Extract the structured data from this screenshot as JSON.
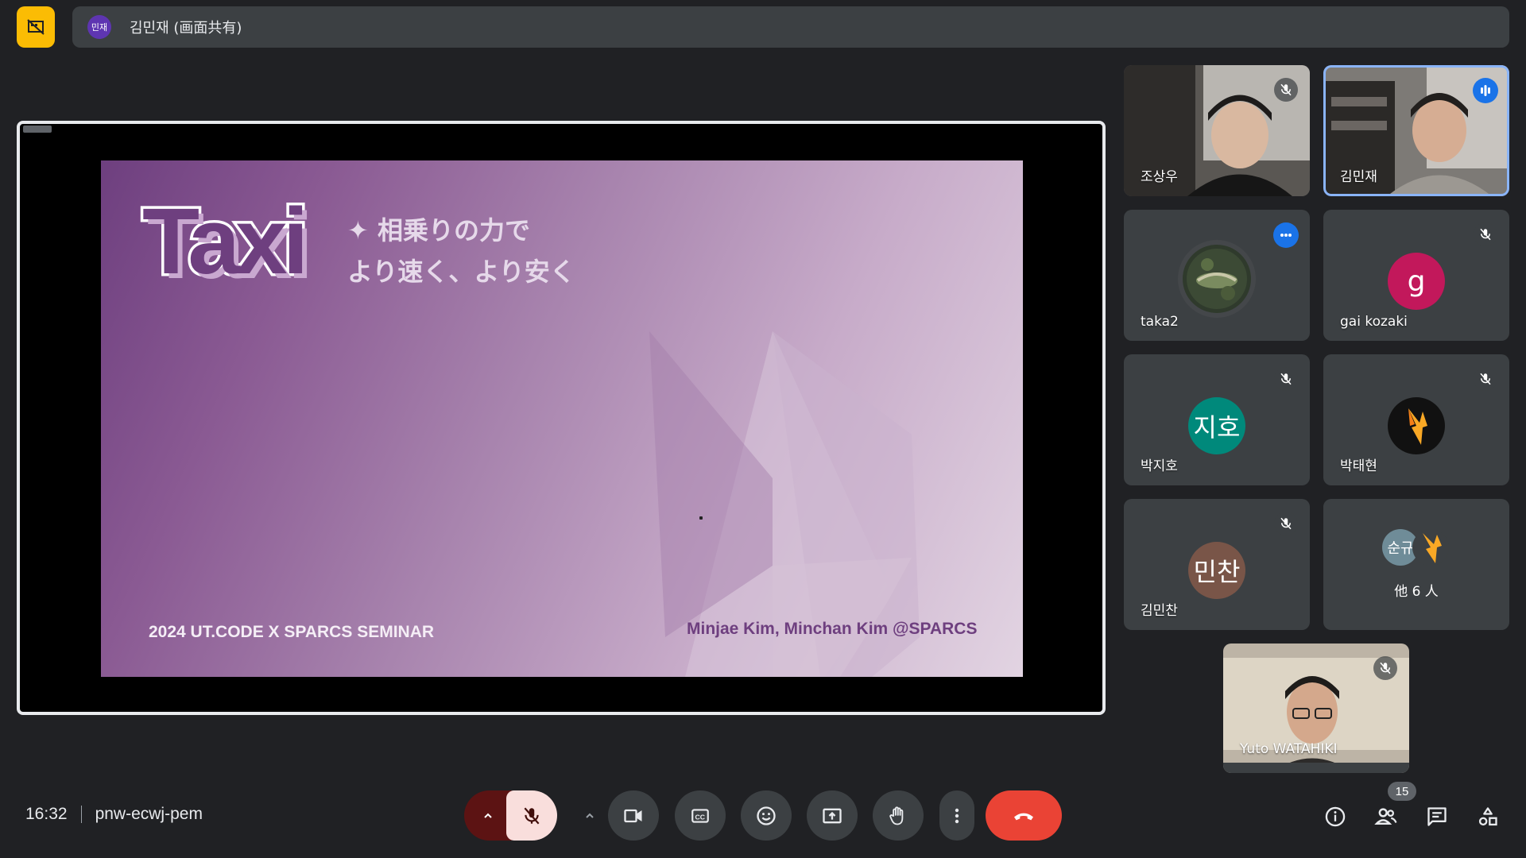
{
  "presenter_bar": {
    "avatar_initials": "민재",
    "label": "김민재 (画面共有)"
  },
  "slide": {
    "logo": "Taxi",
    "tagline_line1": "✦ 相乗りの力で",
    "tagline_line2": "より速く、より安く",
    "footer_left": "2024 UT.CODE X SPARCS SEMINAR",
    "footer_right": "Minjae Kim, Minchan Kim @SPARCS"
  },
  "participants": [
    {
      "name": "조상우",
      "type": "video",
      "mic": "muted"
    },
    {
      "name": "김민재",
      "type": "video",
      "mic": "speaking"
    },
    {
      "name": "taka2",
      "type": "photo",
      "mic": "speaking"
    },
    {
      "name": "gai kozaki",
      "type": "initial",
      "initial": "g",
      "color": "#c2185b",
      "mic": "muted"
    },
    {
      "name": "박지호",
      "type": "initial",
      "initial": "지호",
      "color": "#00897b",
      "mic": "muted"
    },
    {
      "name": "박태현",
      "type": "logo",
      "mic": "muted"
    },
    {
      "name": "김민찬",
      "type": "initial",
      "initial": "민찬",
      "color": "#795548",
      "mic": "muted"
    },
    {
      "name": "Yuto WATAHIKI",
      "type": "video",
      "mic": "muted"
    }
  ],
  "others_tile": {
    "avatar_initial": "순규",
    "label": "他 6 人"
  },
  "bottom_bar": {
    "time": "16:32",
    "meeting_code": "pnw-ecwj-pem",
    "participants_count": "15"
  },
  "colors": {
    "accent_yellow": "#fbbc04",
    "end_call_red": "#ea4335",
    "mic_muted_bg": "#f9dedc",
    "speaking_blue": "#1a73e8"
  },
  "icons": [
    "present-off-icon",
    "mic-off-icon",
    "camera-icon",
    "captions-icon",
    "emoji-icon",
    "present-icon",
    "raise-hand-icon",
    "more-vert-icon",
    "end-call-icon",
    "info-icon",
    "people-icon",
    "chat-icon",
    "activities-icon"
  ]
}
